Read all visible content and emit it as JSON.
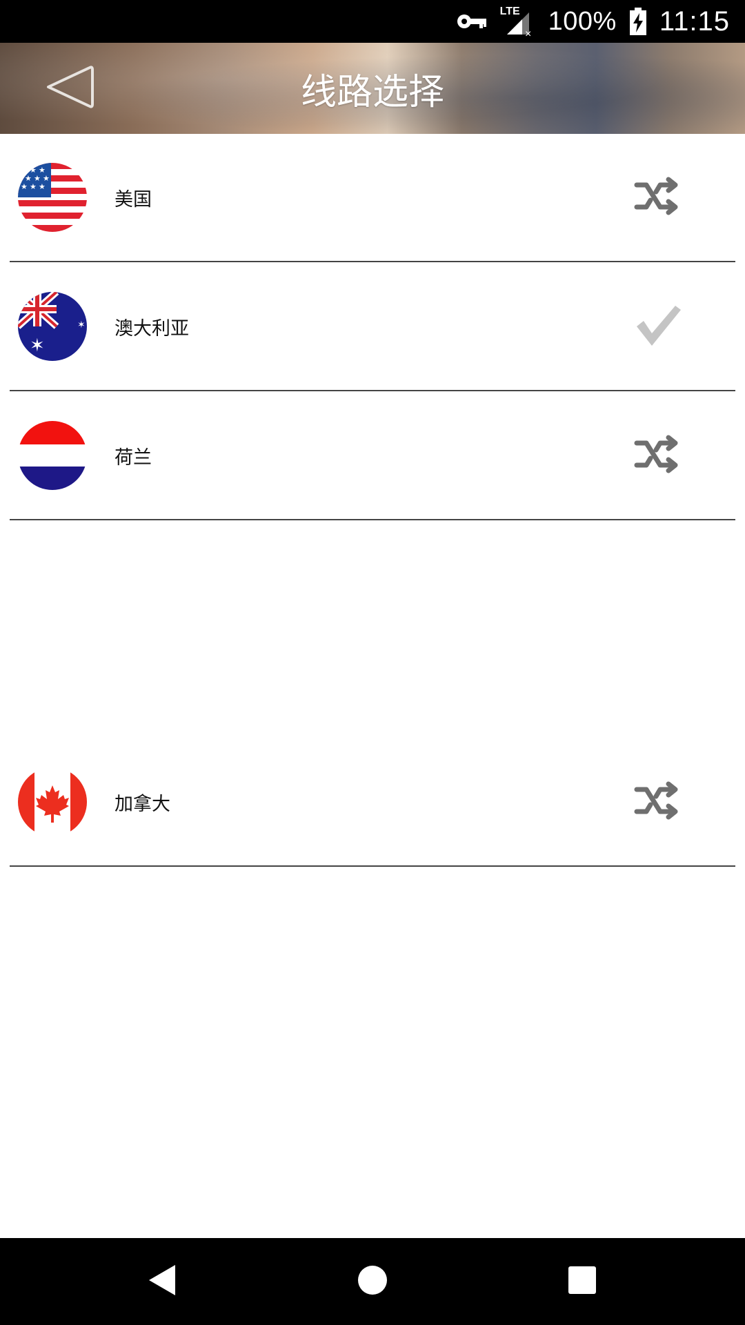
{
  "status_bar": {
    "network": "LTE",
    "battery": "100%",
    "time": "11:15",
    "icons": [
      "vpn-key-icon",
      "signal-icon",
      "battery-charging-icon"
    ]
  },
  "header": {
    "title": "线路选择",
    "back_icon": "back-arrow-icon"
  },
  "routes": [
    {
      "label": "美国",
      "flag": "us-flag-icon",
      "action_icon": "shuffle-icon"
    },
    {
      "label": "澳大利亚",
      "flag": "australia-flag-icon",
      "action_icon": "checkmark-icon",
      "selected": true
    },
    {
      "label": "荷兰",
      "flag": "netherlands-flag-icon",
      "action_icon": "shuffle-icon"
    },
    {
      "label": "加拿大",
      "flag": "canada-flag-icon",
      "action_icon": "shuffle-icon"
    }
  ],
  "colors": {
    "icon_gray": "#6f6f6f",
    "check_gray": "#c4c4c4",
    "divider": "#444444"
  },
  "nav_bar": {
    "icons": [
      "nav-back-icon",
      "nav-home-icon",
      "nav-recents-icon"
    ]
  }
}
